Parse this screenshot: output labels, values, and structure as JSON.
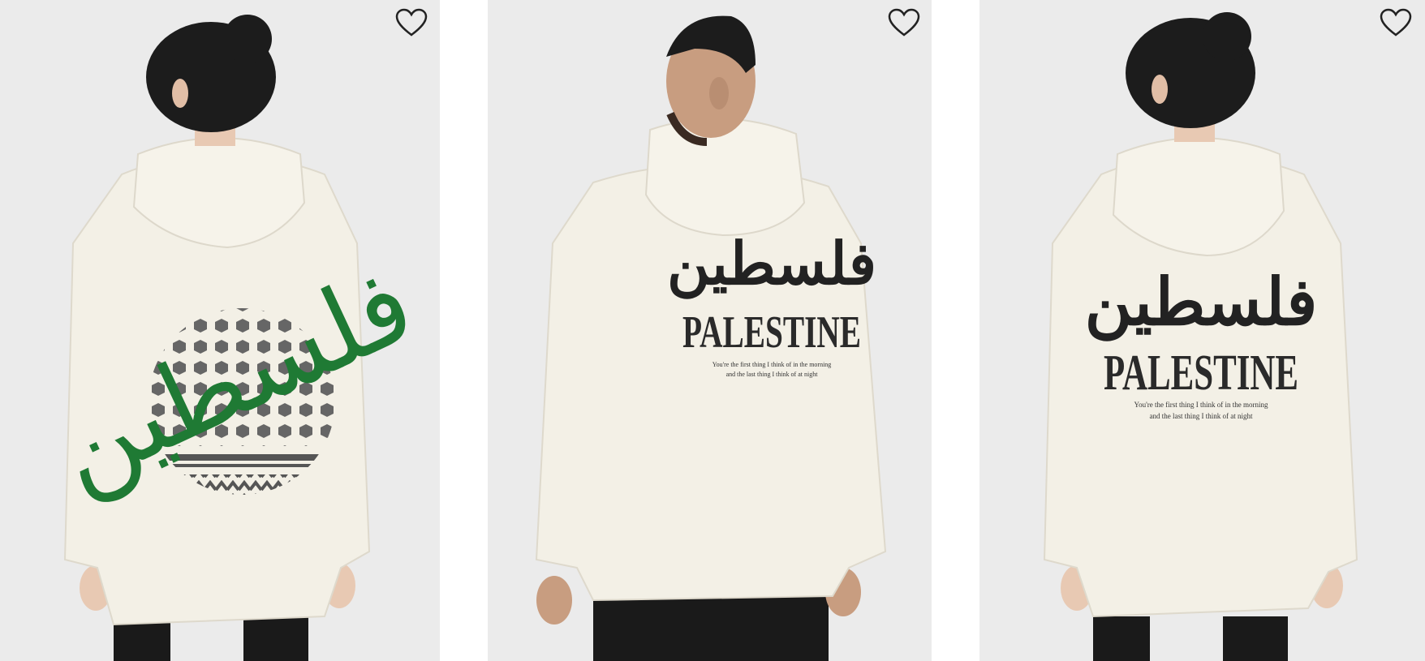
{
  "products": [
    {
      "print": {
        "arabic": "فلسطين"
      },
      "wishlist": {
        "icon": "heart-icon"
      }
    },
    {
      "print": {
        "arabic": "فلسطين",
        "title": "PALESTINE",
        "tagline_line1": "You're the first thing I think of in the morning",
        "tagline_line2": "and the last thing I think of at night"
      },
      "wishlist": {
        "icon": "heart-icon"
      }
    },
    {
      "print": {
        "arabic": "فلسطين",
        "title": "PALESTINE",
        "tagline_line1": "You're the first thing I think of in the morning",
        "tagline_line2": "and the last thing I think of at night"
      },
      "wishlist": {
        "icon": "heart-icon"
      }
    }
  ],
  "colors": {
    "background": "#eaeaea",
    "hoodie": "#f3f0e6",
    "print_green": "#1f7a34",
    "print_gray": "#555555",
    "print_black": "#222222"
  }
}
